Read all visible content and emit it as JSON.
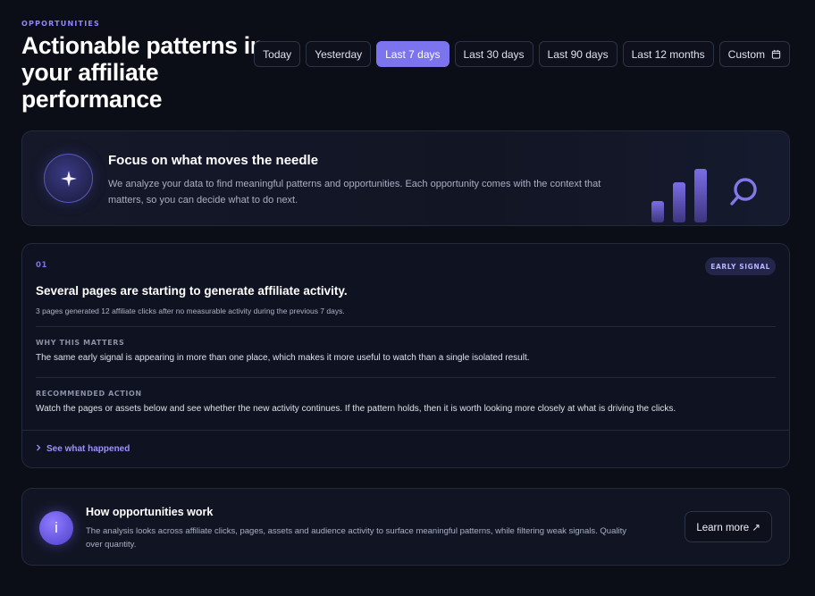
{
  "header": {
    "eyebrow": "OPPORTUNITIES",
    "title": "Actionable patterns in your affiliate performance"
  },
  "date_ranges": {
    "options": [
      "Today",
      "Yesterday",
      "Last 7 days",
      "Last 30 days",
      "Last 90 days",
      "Last 12 months",
      "Custom"
    ],
    "selected": "Last 7 days",
    "custom_icon": "calendar-icon"
  },
  "hero": {
    "icon": "sparkle-icon",
    "title": "Focus on what moves the needle",
    "text": "We analyze your data to find meaningful patterns and opportunities. Each opportunity comes with the context that matters, so you can decide what to do next.",
    "art_icons": [
      "bar-chart-icon",
      "magnifier-icon"
    ]
  },
  "opportunity": {
    "number": "01",
    "tag": "EARLY SIGNAL",
    "title": "Several pages are starting to generate affiliate activity.",
    "summary": "3 pages generated 12 affiliate clicks after no measurable activity during the previous 7 days.",
    "why_label": "WHY THIS MATTERS",
    "why_text": "The same early signal is appearing in more than one place, which makes it more useful to watch than a single isolated result.",
    "action_label": "RECOMMENDED ACTION",
    "action_text": "Watch the pages or assets below and see whether the new activity continues. If the pattern holds, then it is worth looking more closely at what is driving the clicks.",
    "link": "See what happened"
  },
  "info": {
    "icon_letter": "i",
    "title": "How opportunities work",
    "text": "The analysis looks across affiliate clicks, pages, assets and audience activity to surface meaningful patterns, while filtering weak signals. Quality over quantity.",
    "button": "Learn more ↗"
  },
  "colors": {
    "background": "#0b0d17",
    "accent": "#7c74ef",
    "card_border": "#222a3b"
  }
}
